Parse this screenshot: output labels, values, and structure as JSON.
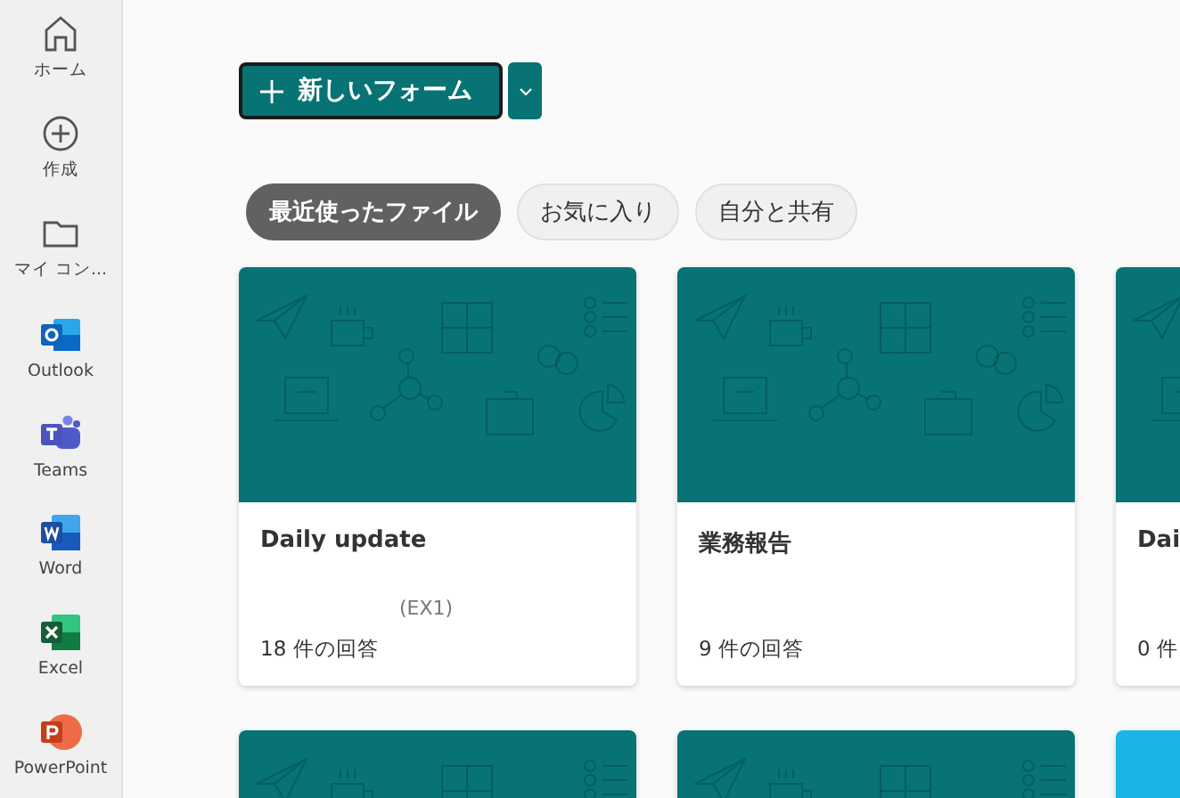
{
  "sidebar": {
    "items": [
      {
        "kind": "home",
        "label": "ホーム"
      },
      {
        "kind": "create",
        "label": "作成"
      },
      {
        "kind": "folder",
        "label": "マイ コン..."
      },
      {
        "kind": "outlook",
        "label": "Outlook"
      },
      {
        "kind": "teams",
        "label": "Teams"
      },
      {
        "kind": "word",
        "label": "Word"
      },
      {
        "kind": "excel",
        "label": "Excel"
      },
      {
        "kind": "powerpoint",
        "label": "PowerPoint"
      }
    ]
  },
  "new_form_button": {
    "label": "新しいフォーム"
  },
  "filters": [
    {
      "label": "最近使ったファイル",
      "selected": true
    },
    {
      "label": "お気に入り",
      "selected": false
    },
    {
      "label": "自分と共有",
      "selected": false
    }
  ],
  "cards": [
    {
      "color": "#077375",
      "title": "Daily update",
      "subtitle": "(EX1)",
      "responses": "18 件の回答"
    },
    {
      "color": "#077375",
      "title": "業務報告",
      "responses": "9 件の回答"
    },
    {
      "color": "#077375",
      "title": "Dai",
      "responses": "0 件"
    },
    {
      "color": "#077375"
    },
    {
      "color": "#077375"
    },
    {
      "color": "#1ab4e6"
    }
  ]
}
